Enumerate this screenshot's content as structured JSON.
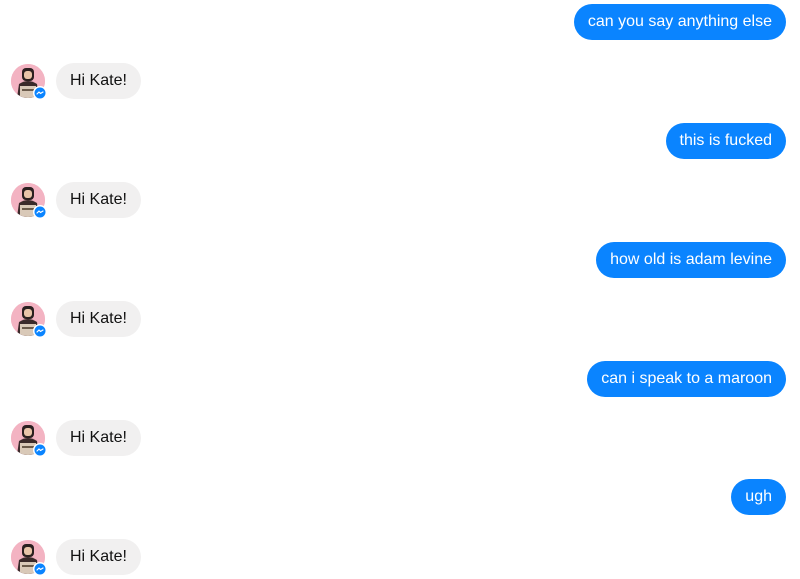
{
  "colors": {
    "sent_bubble": "#0a84ff",
    "received_bubble": "#f1f0f0",
    "badge": "#0a84ff"
  },
  "messages": [
    {
      "from": "me",
      "text": "can you say anything else"
    },
    {
      "from": "bot",
      "text": "Hi Kate!",
      "avatar_icon": "avatar-photo",
      "badge_icon": "messenger-badge-icon"
    },
    {
      "from": "me",
      "text": "this is fucked"
    },
    {
      "from": "bot",
      "text": "Hi Kate!",
      "avatar_icon": "avatar-photo",
      "badge_icon": "messenger-badge-icon"
    },
    {
      "from": "me",
      "text": "how old is adam levine"
    },
    {
      "from": "bot",
      "text": "Hi Kate!",
      "avatar_icon": "avatar-photo",
      "badge_icon": "messenger-badge-icon"
    },
    {
      "from": "me",
      "text": "can i speak to a maroon"
    },
    {
      "from": "bot",
      "text": "Hi Kate!",
      "avatar_icon": "avatar-photo",
      "badge_icon": "messenger-badge-icon"
    },
    {
      "from": "me",
      "text": "ugh"
    },
    {
      "from": "bot",
      "text": "Hi Kate!",
      "avatar_icon": "avatar-photo",
      "badge_icon": "messenger-badge-icon"
    }
  ]
}
